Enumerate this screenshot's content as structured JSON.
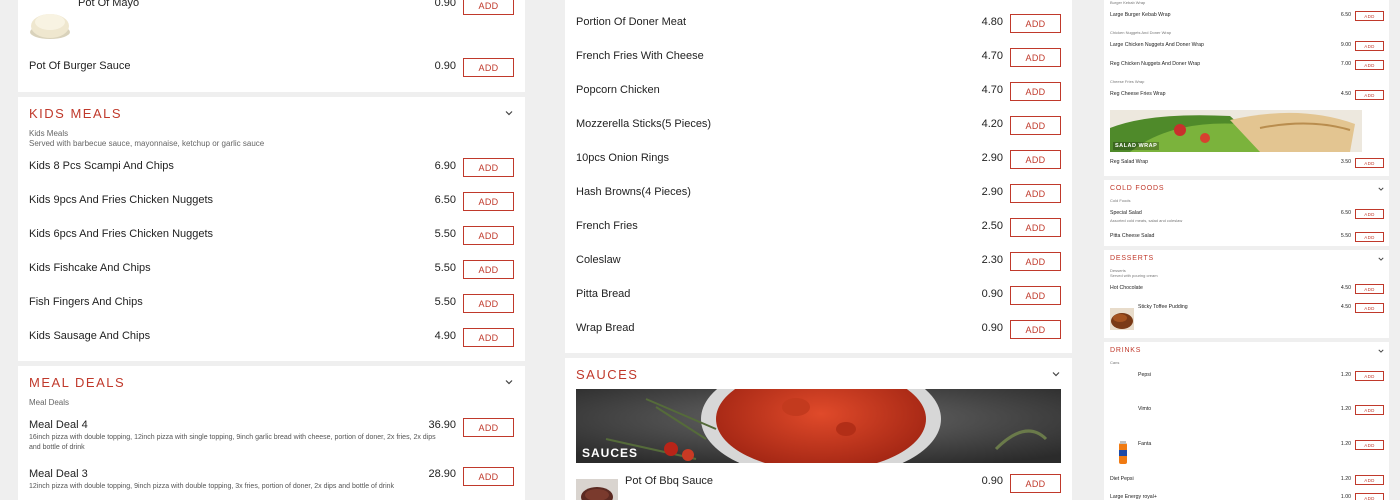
{
  "colors": {
    "accent": "#c0392b",
    "page_bg": "#efefef",
    "card_bg": "#ffffff"
  },
  "add_label": "ADD",
  "col1": {
    "top_items": [
      {
        "name": "Pot Of Mayo",
        "price": "0.90"
      },
      {
        "name": "Pot Of Burger Sauce",
        "price": "0.90"
      }
    ],
    "kids": {
      "title": "KIDS MEALS",
      "sub_title": "Kids Meals",
      "sub_desc": "Served with barbecue sauce, mayonnaise, ketchup or garlic sauce",
      "items": [
        {
          "name": "Kids 8 Pcs Scampi And Chips",
          "price": "6.90"
        },
        {
          "name": "Kids 9pcs And Fries Chicken Nuggets",
          "price": "6.50"
        },
        {
          "name": "Kids 6pcs And Fries Chicken Nuggets",
          "price": "5.50"
        },
        {
          "name": "Kids Fishcake And Chips",
          "price": "5.50"
        },
        {
          "name": "Fish Fingers And Chips",
          "price": "5.50"
        },
        {
          "name": "Kids Sausage And Chips",
          "price": "4.90"
        }
      ]
    },
    "meal": {
      "title": "MEAL DEALS",
      "sub_title": "Meal Deals",
      "items": [
        {
          "name": "Meal Deal 4",
          "price": "36.90",
          "desc": "16inch pizza with double topping, 12inch pizza with single topping, 9inch garlic bread with cheese, portion of doner, 2x fries, 2x dips and bottle of drink"
        },
        {
          "name": "Meal Deal 3",
          "price": "28.90",
          "desc": "12inch pizza with double topping, 9inch pizza with double topping, 3x fries, portion of doner, 2x dips and bottle of drink"
        }
      ]
    }
  },
  "col2": {
    "items": [
      {
        "name": "Portion Of Doner Meat",
        "price": "4.80"
      },
      {
        "name": "French Fries With Cheese",
        "price": "4.70"
      },
      {
        "name": "Popcorn Chicken",
        "price": "4.70"
      },
      {
        "name": "Mozzerella Sticks(5 Pieces)",
        "price": "4.20"
      },
      {
        "name": "10pcs Onion Rings",
        "price": "2.90"
      },
      {
        "name": "Hash Browns(4 Pieces)",
        "price": "2.90"
      },
      {
        "name": "French Fries",
        "price": "2.50"
      },
      {
        "name": "Coleslaw",
        "price": "2.30"
      },
      {
        "name": "Pitta Bread",
        "price": "0.90"
      },
      {
        "name": "Wrap Bread",
        "price": "0.90"
      }
    ],
    "sauces": {
      "title": "SAUCES",
      "banner_label": "SAUCES",
      "items": [
        {
          "name": "Pot Of Bbq Sauce",
          "price": "0.90"
        }
      ]
    }
  },
  "col3": {
    "wraps": {
      "group_labels": [
        "Burger Kebab Wrap",
        "Chicken Nuggets And Doner Wrap",
        "Cheese Fries Wrap"
      ],
      "items": [
        {
          "name": "Large Burger Kebab Wrap",
          "price": "6.50"
        },
        {
          "name": "Large Chicken Nuggets And Doner Wrap",
          "price": "9.00"
        },
        {
          "name": "Reg Chicken Nuggets And Doner Wrap",
          "price": "7.00"
        },
        {
          "name": "Reg Cheese Fries Wrap",
          "price": "4.50"
        }
      ],
      "banner_label": "SALAD WRAP",
      "salad_item": {
        "name": "Reg Salad Wrap",
        "price": "3.50"
      }
    },
    "cold": {
      "title": "COLD FOODS",
      "sub_title": "Cold Foods",
      "items": [
        {
          "name": "Special Salad",
          "price": "6.50",
          "desc": "Assorted cold meats, salad and coleslaw"
        },
        {
          "name": "Pitta Cheese Salad",
          "price": "5.50"
        }
      ]
    },
    "desserts": {
      "title": "DESSERTS",
      "sub_title": "Desserts",
      "sub_desc": "Served with pouring cream",
      "items": [
        {
          "name": "Hot Chocolate",
          "price": "4.50"
        },
        {
          "name": "Sticky Toffee Pudding",
          "price": "4.50"
        }
      ]
    },
    "drinks": {
      "title": "DRINKS",
      "sub_title": "Cans",
      "items": [
        {
          "name": "Pepsi",
          "price": "1.20"
        },
        {
          "name": "Vimto",
          "price": "1.20"
        },
        {
          "name": "Fanta",
          "price": "1.20"
        },
        {
          "name": "Diet Pepsi",
          "price": "1.20"
        },
        {
          "name": "Large Energy royal+",
          "price": "1.00"
        }
      ]
    }
  }
}
